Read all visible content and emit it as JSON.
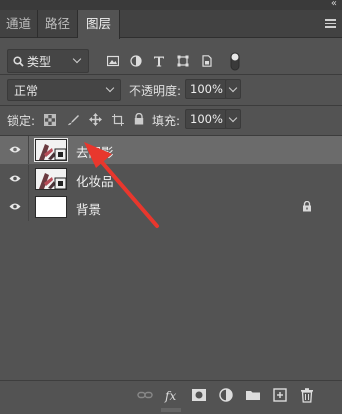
{
  "panel": {
    "collapse_glyph": "«",
    "tabs": [
      {
        "label": "通道",
        "active": false
      },
      {
        "label": "路径",
        "active": false
      },
      {
        "label": "图层",
        "active": true
      }
    ]
  },
  "filter": {
    "kind_label": "类型",
    "filter_icons": [
      "image-filter-icon",
      "adjustment-filter-icon",
      "type-filter-icon",
      "shape-filter-icon",
      "smart-object-filter-icon"
    ]
  },
  "blend": {
    "mode": "正常",
    "opacity_label": "不透明度:",
    "opacity_value": "100%"
  },
  "locks": {
    "label": "锁定:",
    "fill_label": "填充:",
    "fill_value": "100%"
  },
  "layers": [
    {
      "name": "去阴影",
      "selected": true,
      "thumb": "portrait",
      "locked": false
    },
    {
      "name": "化妆品",
      "selected": false,
      "thumb": "portrait",
      "locked": false
    },
    {
      "name": "背景",
      "selected": false,
      "thumb": "white",
      "locked": true
    }
  ],
  "annotation": {
    "color": "#e8372d"
  },
  "colors": {
    "panel_bg": "#535353",
    "selected_row": "#6b6b6b",
    "tab_bar": "#424242"
  }
}
